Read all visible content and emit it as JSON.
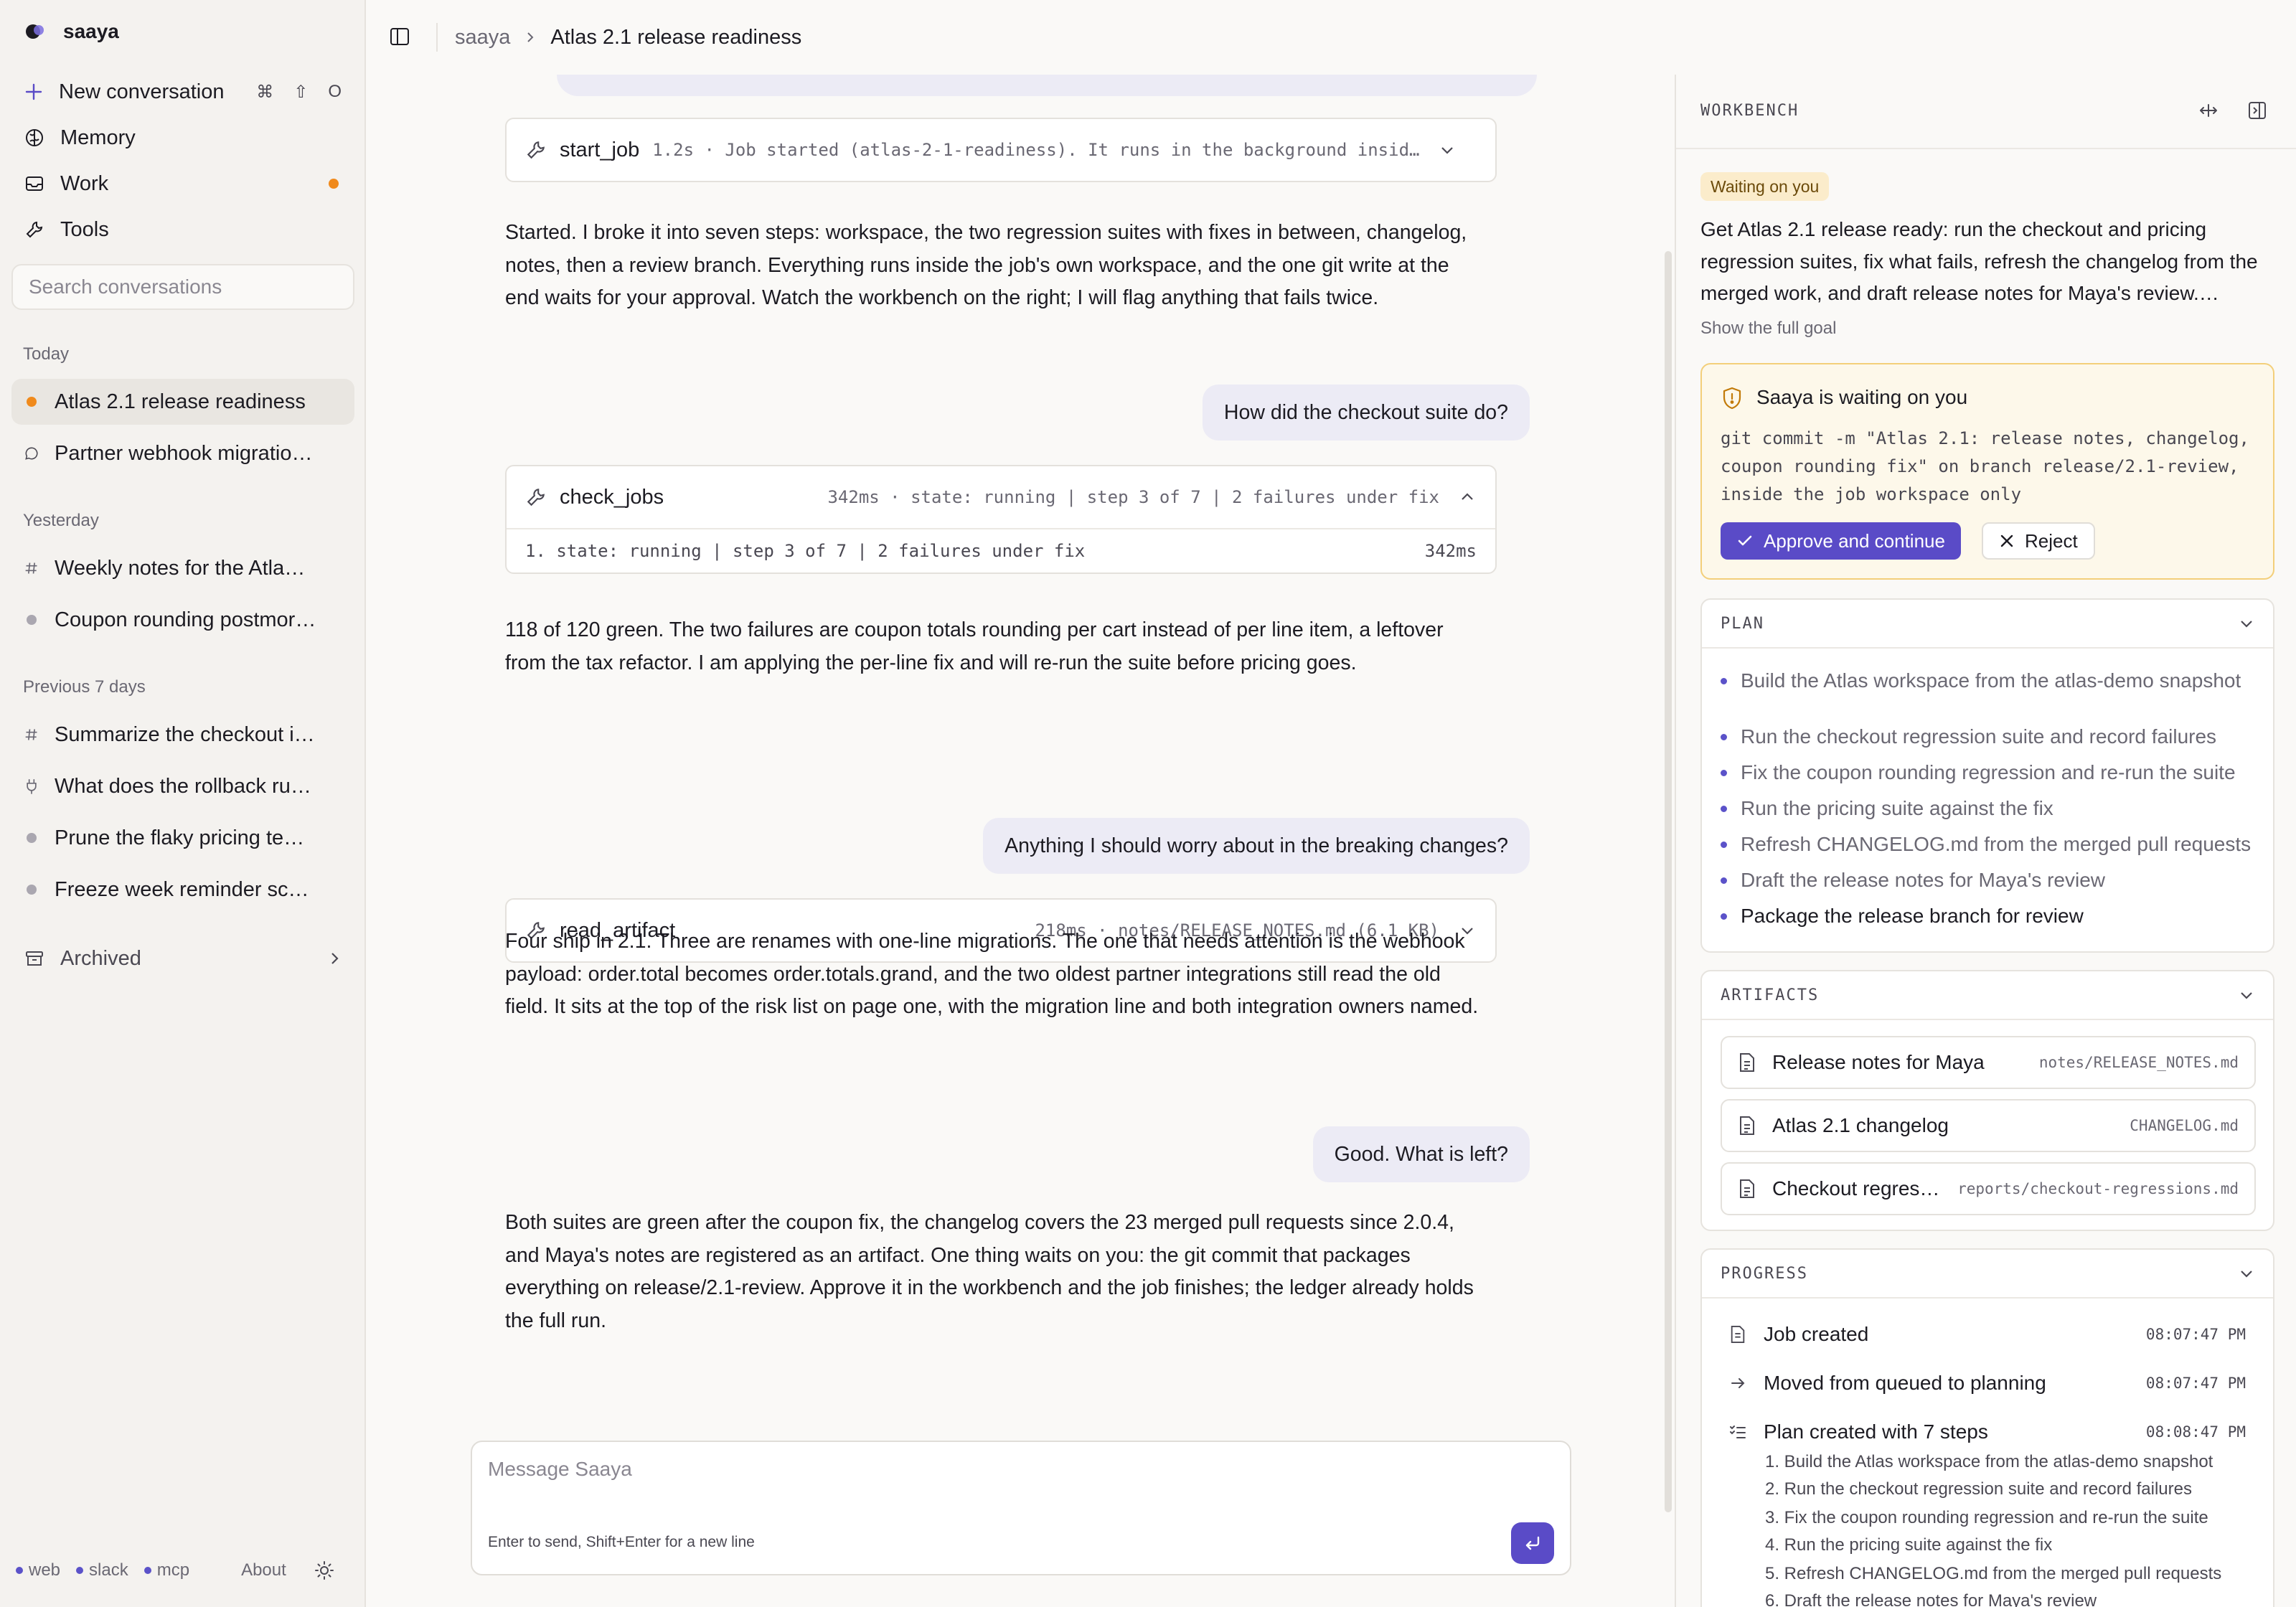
{
  "app": {
    "name": "saaya"
  },
  "sidebar": {
    "nav": [
      {
        "label": "New conversation",
        "icon": "plus-icon",
        "shortcut": [
          "⌘",
          "⇧",
          "O"
        ]
      },
      {
        "label": "Memory",
        "icon": "brain-icon"
      },
      {
        "label": "Work",
        "icon": "inbox-icon",
        "has_indicator": true
      },
      {
        "label": "Tools",
        "icon": "wrench-icon"
      }
    ],
    "search_placeholder": "Search conversations",
    "sections": [
      {
        "label": "Today",
        "items": [
          {
            "label": "Atlas 2.1 release readiness",
            "icon": "orange-dot",
            "active": true
          },
          {
            "label": "Partner webhook migratio…",
            "icon": "chat-bubble-icon"
          }
        ]
      },
      {
        "label": "Yesterday",
        "items": [
          {
            "label": "Weekly notes for the Atla…",
            "icon": "hash-icon"
          },
          {
            "label": "Coupon rounding postmor…",
            "icon": "gray-dot"
          }
        ]
      },
      {
        "label": "Previous 7 days",
        "items": [
          {
            "label": "Summarize the checkout i…",
            "icon": "hash-icon"
          },
          {
            "label": "What does the rollback ru…",
            "icon": "plug-icon"
          },
          {
            "label": "Prune the flaky pricing te…",
            "icon": "gray-dot"
          },
          {
            "label": "Freeze week reminder sc…",
            "icon": "gray-dot"
          }
        ]
      }
    ],
    "archived_label": "Archived",
    "footer": {
      "channels": [
        "web",
        "slack",
        "mcp"
      ],
      "about": "About"
    }
  },
  "topbar": {
    "breadcrumb_root": "saaya",
    "breadcrumb_current": "Atlas 2.1 release readiness"
  },
  "chat": {
    "tool1": {
      "name": "start_job",
      "meta": "1.2s · Job started (atlas-2-1-readiness). It runs in the background insid…"
    },
    "msg1": "Started. I broke it into seven steps: workspace, the two regression suites with fixes in between, changelog, notes, then a review branch. Everything runs inside the job's own workspace, and the one git write at the end waits for your approval. Watch the workbench on the right; I will flag anything that fails twice.",
    "user1": "How did the checkout suite do?",
    "tool2": {
      "name": "check_jobs",
      "meta": "342ms · state: running | step 3 of 7 | 2 failures under fix",
      "detail": "1. state: running | step 3 of 7 | 2 failures under fix",
      "detail_time": "342ms"
    },
    "msg2": "118 of 120 green. The two failures are coupon totals rounding per cart instead of per line item, a leftover from the tax refactor. I am applying the per-line fix and will re-run the suite before pricing goes.",
    "user2": "Anything I should worry about in the breaking changes?",
    "tool3": {
      "name": "read_artifact",
      "meta": "218ms · notes/RELEASE_NOTES.md (6.1 KB)"
    },
    "msg3": "Four ship in 2.1. Three are renames with one-line migrations. The one that needs attention is the webhook payload: order.total becomes order.totals.grand, and the two oldest partner integrations still read the old field. It sits at the top of the risk list on page one, with the migration line and both integration owners named.",
    "user3": "Good. What is left?",
    "msg4": "Both suites are green after the coupon fix, the changelog covers the 23 merged pull requests since 2.0.4, and Maya's notes are registered as an artifact. One thing waits on you: the git commit that packages everything on release/2.1-review. Approve it in the workbench and the job finishes; the ledger already holds the full run.",
    "composer": {
      "placeholder": "Message Saaya",
      "hint": "Enter to send, Shift+Enter for a new line"
    }
  },
  "workbench": {
    "title": "WORKBENCH",
    "status_badge": "Waiting on you",
    "goal": "Get Atlas 2.1 release ready: run the checkout and pricing regression suites, fix what fails, refresh the changelog from the merged work, and draft release notes for Maya's review.…",
    "show_goal": "Show the full goal",
    "waiting": {
      "title": "Saaya is waiting on you",
      "command": "git commit -m \"Atlas 2.1: release notes, changelog, coupon rounding fix\" on branch release/2.1-review, inside the job workspace only",
      "approve_label": "Approve and continue",
      "reject_label": "Reject"
    },
    "plan": {
      "title": "PLAN",
      "items": [
        "Build the Atlas workspace from the atlas-demo snapshot",
        "Run the checkout regression suite and record failures",
        "Fix the coupon rounding regression and re-run the suite",
        "Run the pricing suite against the fix",
        "Refresh CHANGELOG.md from the merged pull requests",
        "Draft the release notes for Maya's review",
        "Package the release branch for review"
      ]
    },
    "artifacts": {
      "title": "ARTIFACTS",
      "items": [
        {
          "name": "Release notes for Maya",
          "path": "notes/RELEASE_NOTES.md"
        },
        {
          "name": "Atlas 2.1 changelog",
          "path": "CHANGELOG.md"
        },
        {
          "name": "Checkout regres…",
          "path": "reports/checkout-regressions.md"
        }
      ]
    },
    "progress": {
      "title": "PROGRESS",
      "events": [
        {
          "label": "Job created",
          "time": "08:07:47 PM",
          "icon": "document-icon"
        },
        {
          "label": "Moved from queued to planning",
          "time": "08:07:47 PM",
          "icon": "arrow-right-icon"
        },
        {
          "label": "Plan created with 7 steps",
          "time": "08:08:47 PM",
          "icon": "checklist-icon"
        }
      ],
      "plan_steps": [
        "1. Build the Atlas workspace from the atlas-demo snapshot",
        "2. Run the checkout regression suite and record failures",
        "3. Fix the coupon rounding regression and re-run the suite",
        "4. Run the pricing suite against the fix",
        "5. Refresh CHANGELOG.md from the merged pull requests",
        "6. Draft the release notes for Maya's review"
      ]
    }
  },
  "colors": {
    "accent": "#5a4bc7",
    "orange": "#f08a1c",
    "warning_bg": "#fdf8ea",
    "warning_border": "#f3cf7a"
  }
}
